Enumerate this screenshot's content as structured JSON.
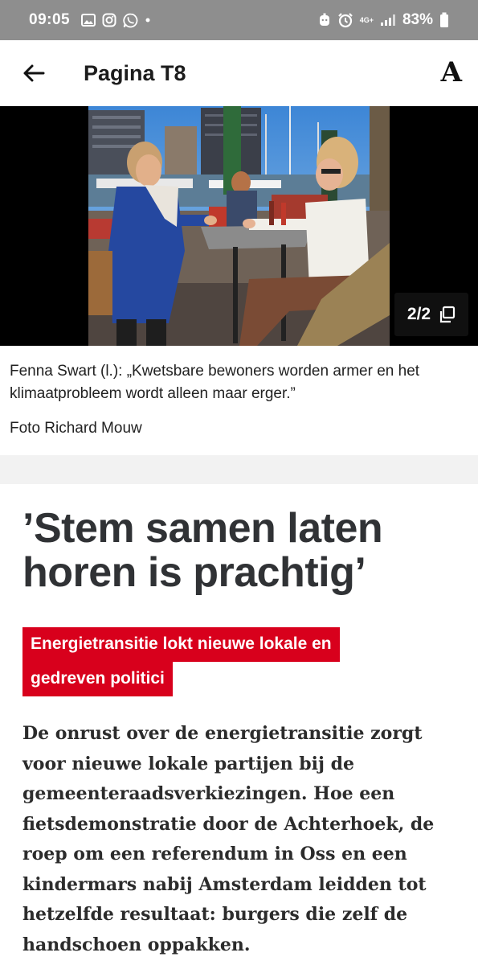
{
  "status_bar": {
    "time": "09:05",
    "network_label": "4G+",
    "battery": "83%"
  },
  "app_bar": {
    "title": "Pagina T8",
    "font_button": "A"
  },
  "photo": {
    "counter": "2/2"
  },
  "caption": {
    "text": "Fenna Swart (l.): „Kwetsbare bewoners worden armer en het klimaatprobleem wordt alleen maar erger.”",
    "credit": "Foto Richard Mouw"
  },
  "article": {
    "headline": "’Stem samen laten horen is prachtig’",
    "subhead_lines": [
      "Energietransitie lokt nieuwe lokale en",
      "gedreven politici"
    ],
    "intro": "De onrust over de energietransitie zorgt voor nieuwe lokale partijen bij de gemeenteraadsverkiezingen. Hoe een fietsdemonstratie door de Achterhoek, de roep om een referendum in Oss en een kindermars nabij Amsterdam leidden tot hetzelfde resultaat: burgers die zelf de handschoen oppakken."
  },
  "colors": {
    "status_bar_bg": "#8e8e8e",
    "accent_red": "#d8001c",
    "headline_text": "#303235"
  },
  "icons": [
    "gallery-icon",
    "instagram-icon",
    "whatsapp-icon",
    "dot-icon",
    "face-icon",
    "alarm-icon",
    "signal-icon",
    "battery-icon",
    "back-arrow-icon",
    "copy-icon"
  ]
}
